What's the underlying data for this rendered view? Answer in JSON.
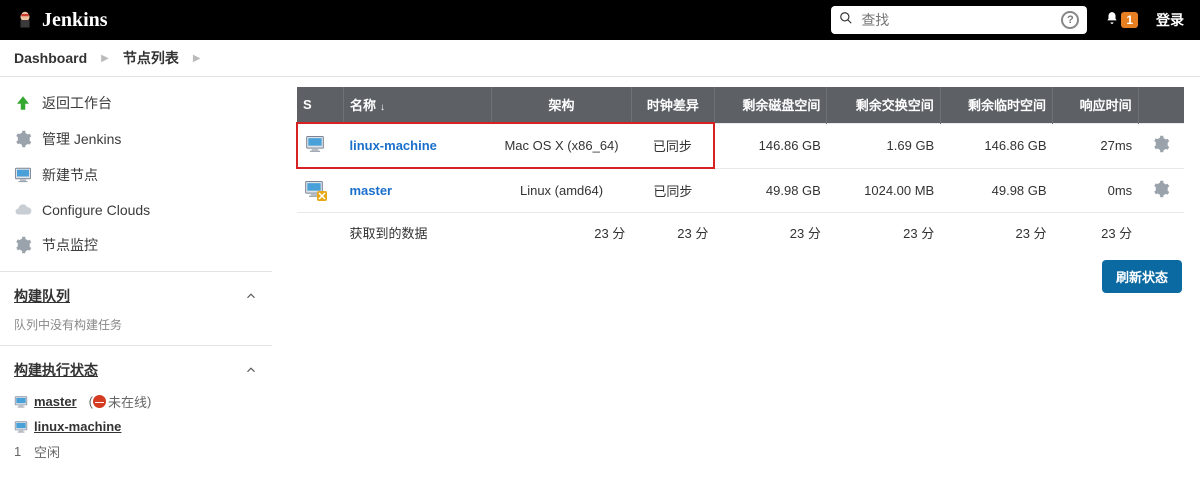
{
  "header": {
    "app_name": "Jenkins",
    "search_placeholder": "查找",
    "notification_count": "1",
    "login_label": "登录"
  },
  "breadcrumbs": {
    "dashboard": "Dashboard",
    "nodes": "节点列表"
  },
  "sidebar": {
    "items": [
      {
        "label": "返回工作台",
        "icon": "arrow-up"
      },
      {
        "label": "管理 Jenkins",
        "icon": "gear"
      },
      {
        "label": "新建节点",
        "icon": "computer-new"
      },
      {
        "label": "Configure Clouds",
        "icon": "cloud"
      },
      {
        "label": "节点监控",
        "icon": "gear"
      }
    ]
  },
  "build_queue": {
    "title": "构建队列",
    "empty_text": "队列中没有构建任务"
  },
  "build_executor": {
    "title": "构建执行状态",
    "items": [
      {
        "name": "master",
        "status": "未在线",
        "offline": true
      },
      {
        "name": "linux-machine",
        "offline": false
      }
    ],
    "slot": {
      "index": "1",
      "label": "空闲"
    }
  },
  "table": {
    "columns": {
      "s": "S",
      "name": "名称",
      "arch": "架构",
      "clock": "时钟差异",
      "disk": "剩余磁盘空间",
      "swap": "剩余交换空间",
      "temp": "剩余临时空间",
      "response": "响应时间"
    },
    "rows": [
      {
        "name": "linux-machine",
        "arch": "Mac OS X (x86_64)",
        "clock": "已同步",
        "disk": "146.86 GB",
        "swap": "1.69 GB",
        "temp": "146.86 GB",
        "response": "27ms",
        "highlight": true,
        "offline": false
      },
      {
        "name": "master",
        "arch": "Linux (amd64)",
        "clock": "已同步",
        "disk": "49.98 GB",
        "swap": "1024.00 MB",
        "temp": "49.98 GB",
        "response": "0ms",
        "highlight": false,
        "offline": true
      }
    ],
    "footer": {
      "label": "获取到的数据",
      "arch": "23 分",
      "clock": "23 分",
      "disk": "23 分",
      "swap": "23 分",
      "temp": "23 分",
      "response": "23 分"
    },
    "refresh_label": "刷新状态"
  }
}
